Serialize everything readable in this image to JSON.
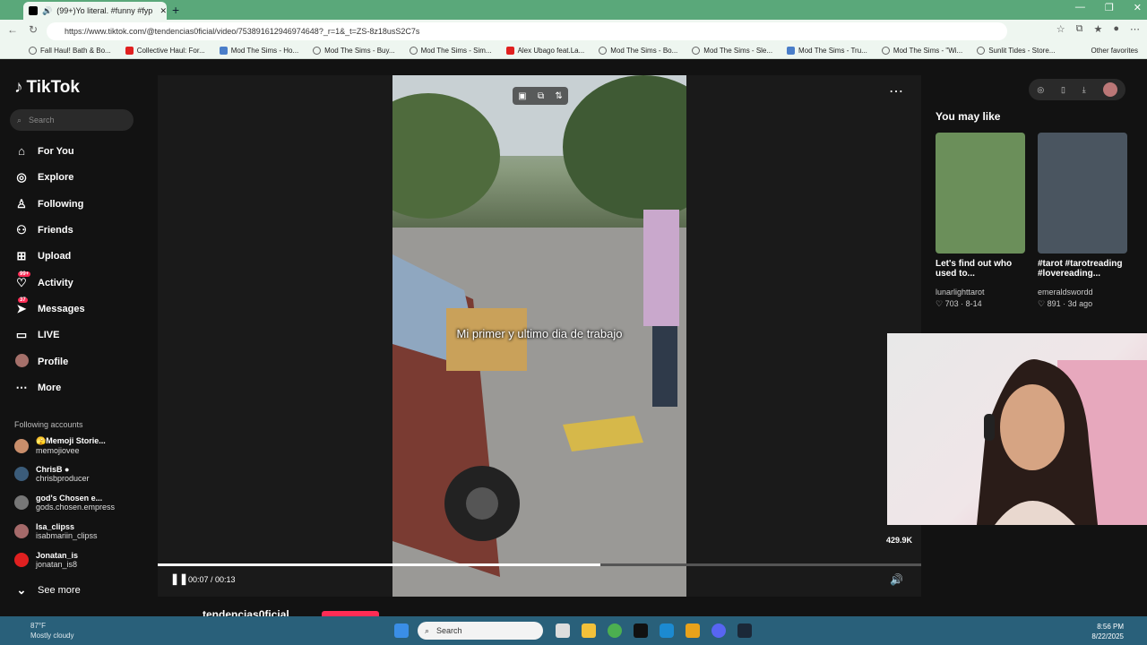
{
  "browser": {
    "tab_title": "(99+)Yo literal. #funny #fyp",
    "url": "https://www.tiktok.com/@tendencias0ficial/video/753891612946974648?_r=1&_t=ZS-8z18usS2C7s",
    "bookmarks": [
      {
        "label": "Fall Haul! Bath & Bo...",
        "icon": "generic"
      },
      {
        "label": "Collective Haul: For...",
        "icon": "youtube"
      },
      {
        "label": "Mod The Sims - Ho...",
        "icon": "modthesims"
      },
      {
        "label": "Mod The Sims - Buy...",
        "icon": "globe"
      },
      {
        "label": "Mod The Sims - Sim...",
        "icon": "globe"
      },
      {
        "label": "Alex Ubago feat.La...",
        "icon": "youtube"
      },
      {
        "label": "Mod The Sims - Bo...",
        "icon": "globe"
      },
      {
        "label": "Mod The Sims - Sle...",
        "icon": "globe"
      },
      {
        "label": "Mod The Sims - Tru...",
        "icon": "modthesims"
      },
      {
        "label": "Mod The Sims - \"Wi...",
        "icon": "globe"
      },
      {
        "label": "Sunlit Tides - Store...",
        "icon": "globe"
      }
    ],
    "other_favorites": "Other favorites"
  },
  "sidebar": {
    "logo": "TikTok",
    "search_placeholder": "Search",
    "nav": [
      {
        "label": "For You",
        "icon": "home-icon"
      },
      {
        "label": "Explore",
        "icon": "compass-icon"
      },
      {
        "label": "Following",
        "icon": "person-icon"
      },
      {
        "label": "Friends",
        "icon": "friends-icon"
      },
      {
        "label": "Upload",
        "icon": "plus-square-icon"
      },
      {
        "label": "Activity",
        "icon": "bell-icon",
        "badge": "99+"
      },
      {
        "label": "Messages",
        "icon": "paper-plane-icon",
        "badge": "37"
      },
      {
        "label": "LIVE",
        "icon": "tv-icon"
      },
      {
        "label": "Profile",
        "icon": "avatar"
      },
      {
        "label": "More",
        "icon": "ellipsis-icon"
      }
    ],
    "following_heading": "Following accounts",
    "following": [
      {
        "name": "🫣Memoji Storie...",
        "handle": "memojiovee",
        "color": "#c98e6b"
      },
      {
        "name": "ChrisB ●",
        "handle": "chrisbproducer",
        "color": "#3b5c7a"
      },
      {
        "name": "god's Chosen e...",
        "handle": "gods.chosen.empress",
        "color": "#777"
      },
      {
        "name": "Isa_clipss",
        "handle": "isabmariin_clipss",
        "color": "#a56a6a"
      },
      {
        "name": "Jonatan_is",
        "handle": "jonatan_is8",
        "color": "#e02020"
      }
    ],
    "see_more": "See more"
  },
  "video": {
    "caption": "Mi primer y ultimo dia de trabajo",
    "time": "00:07 / 00:13",
    "progress_fraction": 0.58,
    "likes_partial": "429.9K",
    "channel": "tendencias0ficial"
  },
  "right_panel": {
    "heading": "You may like",
    "items": [
      {
        "title": "Let's find out who used to...",
        "user": "lunarlighttarot",
        "likes": "703",
        "date": "8-14",
        "color": "#6b8f5a"
      },
      {
        "title": "#tarot #tarotreading #lovereading...",
        "user": "emeraldswordd",
        "likes": "891",
        "date": "3d ago",
        "color": "#4a5560"
      }
    ]
  },
  "taskbar": {
    "temp": "87°F",
    "weather": "Mostly cloudy",
    "search": "Search",
    "time": "8:56 PM",
    "date": "8/22/2025"
  }
}
